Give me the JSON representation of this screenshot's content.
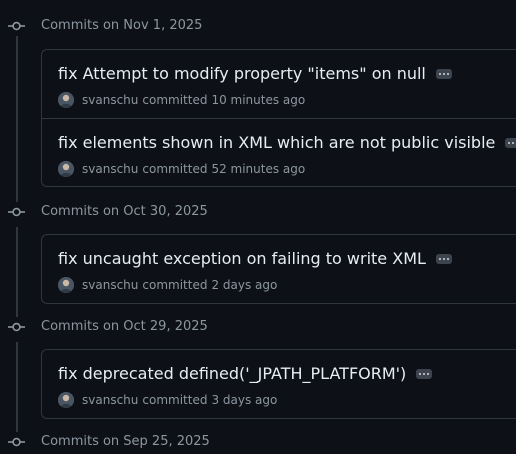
{
  "groups": [
    {
      "label": "Commits on Nov 1, 2025",
      "commits": [
        {
          "title": "fix Attempt to modify property \"items\" on null",
          "author": "svanschu",
          "action": "committed",
          "time": "10 minutes ago"
        },
        {
          "title": "fix elements shown in XML which are not public visible",
          "author": "svanschu",
          "action": "committed",
          "time": "52 minutes ago"
        }
      ]
    },
    {
      "label": "Commits on Oct 30, 2025",
      "commits": [
        {
          "title": "fix uncaught exception on failing to write XML",
          "author": "svanschu",
          "action": "committed",
          "time": "2 days ago"
        }
      ]
    },
    {
      "label": "Commits on Oct 29, 2025",
      "commits": [
        {
          "title": "fix deprecated defined('_JPATH_PLATFORM')",
          "author": "svanschu",
          "action": "committed",
          "time": "3 days ago"
        }
      ]
    },
    {
      "label": "Commits on Sep 25, 2025",
      "commits": []
    }
  ],
  "colors": {
    "background": "#0d1117",
    "border": "#30363d",
    "muted_text": "#8d96a0",
    "primary_text": "#e6edf3"
  },
  "icons": {
    "group_marker": "git-commit-icon",
    "more": "ellipsis-icon",
    "avatar": "user-avatar"
  }
}
